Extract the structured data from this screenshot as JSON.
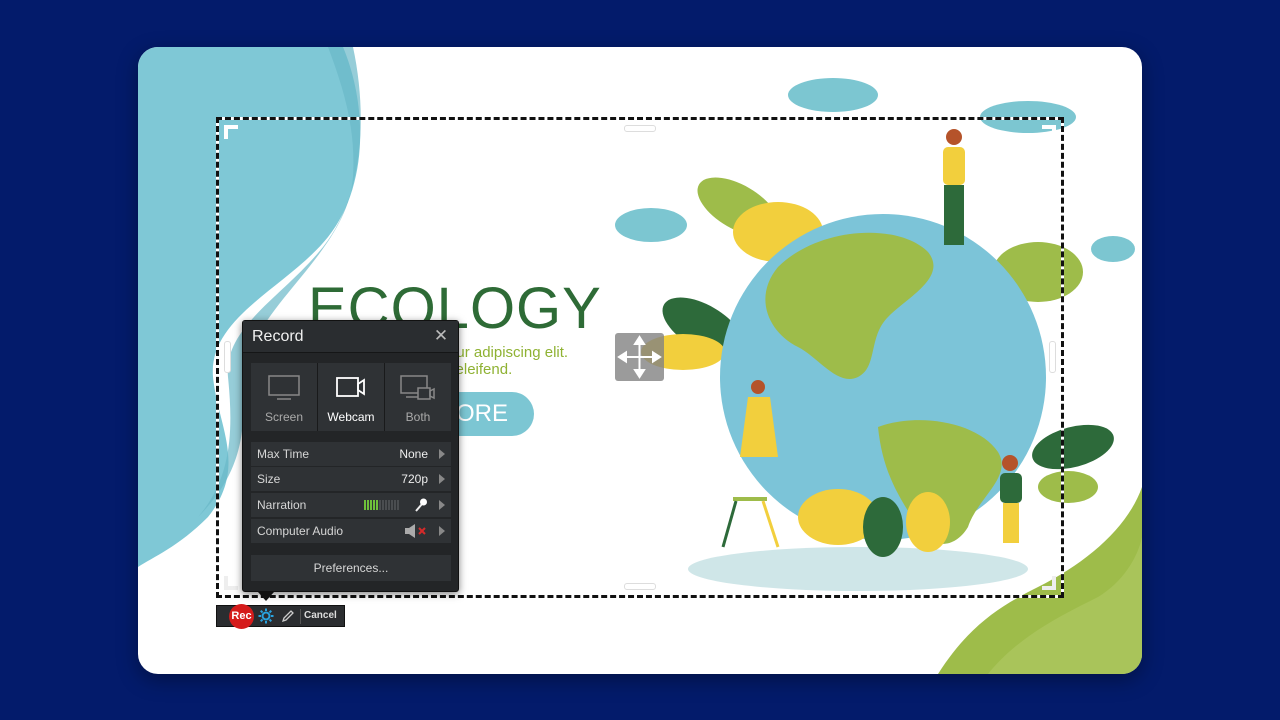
{
  "hero": {
    "title": "ECOLOGY",
    "line1": "nsectetur adipiscing elit.",
    "line2": "ctus in eleifend.",
    "button_label": "ORE"
  },
  "record_panel": {
    "title": "Record",
    "close_icon": "close-icon",
    "modes": [
      {
        "label": "Screen",
        "icon": "monitor-icon",
        "active": false
      },
      {
        "label": "Webcam",
        "icon": "webcam-icon",
        "active": true
      },
      {
        "label": "Both",
        "icon": "monitor-webcam-icon",
        "active": false
      }
    ],
    "settings": [
      {
        "label": "Max Time",
        "value": "None"
      },
      {
        "label": "Size",
        "value": "720p"
      },
      {
        "label": "Narration",
        "value": "",
        "meter_level": 5,
        "meter_total": 12,
        "icon": "microphone-icon"
      },
      {
        "label": "Computer Audio",
        "value": "",
        "icon": "speaker-muted-icon"
      }
    ],
    "preferences_label": "Preferences..."
  },
  "toolbar": {
    "rec_label": "Rec",
    "cancel_label": "Cancel"
  },
  "colors": {
    "page_bg": "#031b6b",
    "rec_red": "#d51b1b",
    "gear_blue": "#29a3e0",
    "meter_green": "#6ec13a",
    "title_green": "#2e6b36",
    "accent_teal": "#7cc6d3"
  }
}
